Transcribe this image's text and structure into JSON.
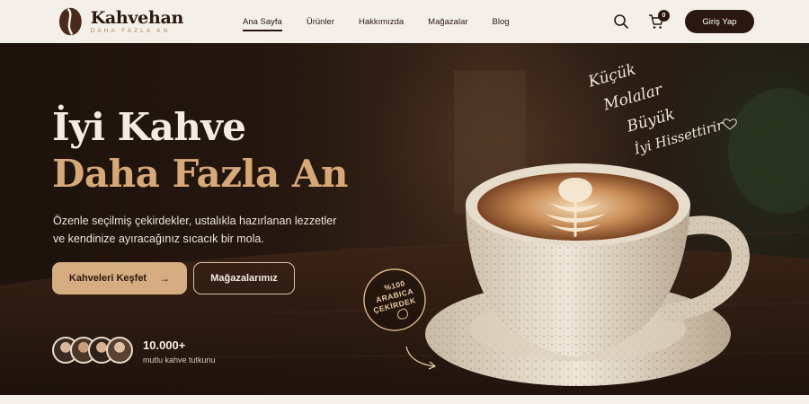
{
  "brand": {
    "name": "Kahvehan",
    "tagline": "DAHA FAZLA AN"
  },
  "nav": {
    "items": [
      {
        "label": "Ana Sayfa",
        "active": true
      },
      {
        "label": "Ürünler",
        "active": false
      },
      {
        "label": "Hakkımızda",
        "active": false
      },
      {
        "label": "Mağazalar",
        "active": false
      },
      {
        "label": "Blog",
        "active": false
      }
    ],
    "cart_count": "0",
    "login_label": "Giriş Yap"
  },
  "hero": {
    "title_line1": "İyi Kahve",
    "title_line2": "Daha Fazla An",
    "description": "Özenle seçilmiş çekirdekler, ustalıkla hazırlanan lezzetler ve kendinize ayıracağınız sıcacık bir mola.",
    "primary_button": "Kahveleri Keşfet",
    "secondary_button": "Mağazalarımız",
    "stat_number": "10.000+",
    "stat_label": "mutlu kahve tutkunu",
    "script_lines": [
      "Küçük",
      "Molalar",
      "Büyük",
      "İyi Hissettirir"
    ],
    "badge_lines": [
      "%100",
      "ARABICA",
      "ÇEKİRDEK"
    ]
  },
  "colors": {
    "accent": "#d6ad80",
    "dark": "#2a1810",
    "background": "#f4efe8"
  },
  "icons": [
    "search-icon",
    "cart-icon",
    "arrow-right-icon",
    "heart-icon",
    "coffee-bean-icon"
  ]
}
